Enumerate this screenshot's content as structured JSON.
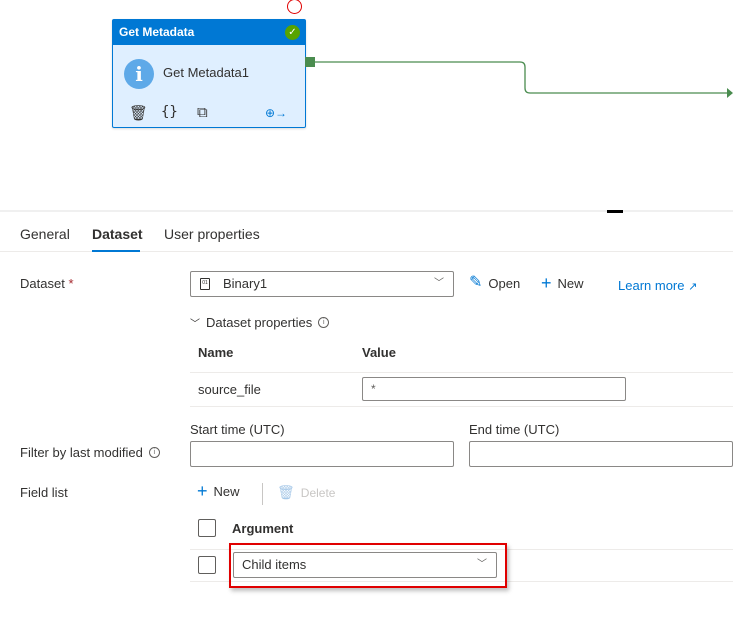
{
  "canvas": {
    "activity": {
      "type_label": "Get Metadata",
      "name": "Get Metadata1",
      "status": "succeeded",
      "icons": {
        "type_icon": "info-icon",
        "status_icon": "check-circle-icon",
        "delete": "trash-icon",
        "code": "braces-icon",
        "copy": "copy-icon",
        "output": "add-output-icon"
      }
    },
    "colors": {
      "node_header": "#0078d4",
      "node_body": "#dfefff",
      "connector": "#4a8c4f",
      "success": "#57a300",
      "highlight": "#e00000"
    }
  },
  "tabs": [
    {
      "label": "General",
      "active": false
    },
    {
      "label": "Dataset",
      "active": true
    },
    {
      "label": "User properties",
      "active": false
    }
  ],
  "dataset": {
    "label": "Dataset",
    "required_marker": "*",
    "selected": "Binary1",
    "open_label": "Open",
    "new_label": "New",
    "learn_more_label": "Learn more"
  },
  "dataset_properties": {
    "title": "Dataset properties",
    "columns": [
      "Name",
      "Value"
    ],
    "rows": [
      {
        "name": "source_file",
        "value": "*"
      }
    ]
  },
  "filter": {
    "label": "Filter by last modified",
    "start_label": "Start time (UTC)",
    "start_value": "",
    "end_label": "End time (UTC)",
    "end_value": ""
  },
  "field_list": {
    "label": "Field list",
    "new_label": "New",
    "delete_label": "Delete",
    "column": "Argument",
    "rows": [
      {
        "argument": "Child items"
      }
    ]
  }
}
